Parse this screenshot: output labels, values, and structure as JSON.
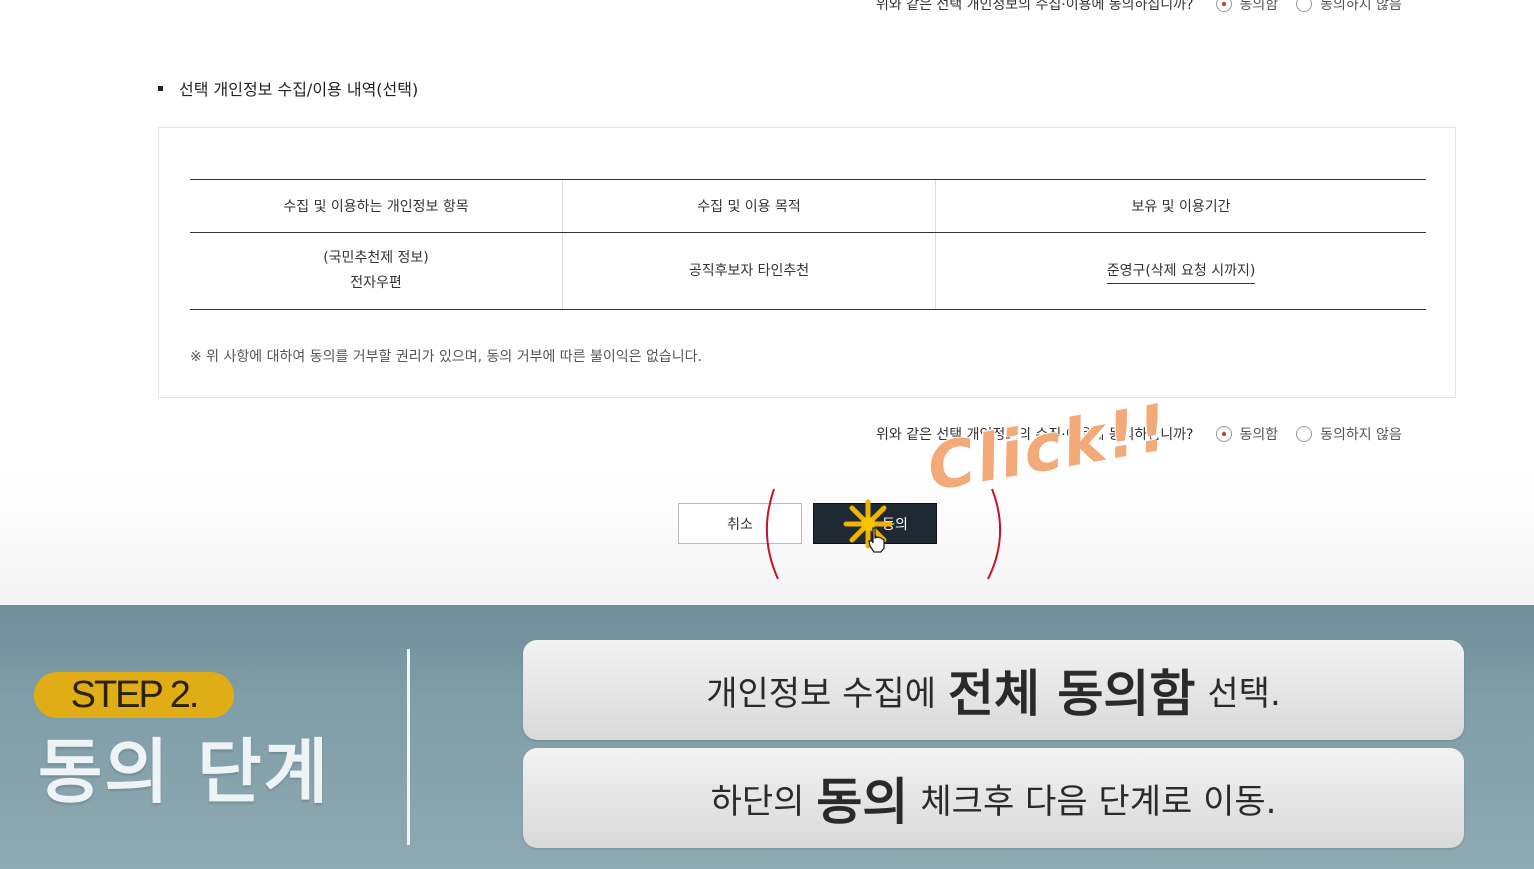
{
  "top_consent": {
    "question": "위와 같은 선택 개인정보의 수집·이용에 동의하십니까?",
    "agree_label": "동의함",
    "disagree_label": "동의하지 않음"
  },
  "section": {
    "title": "선택 개인정보 수집/이용 내역(선택)"
  },
  "table": {
    "headers": [
      "수집 및 이용하는 개인정보 항목",
      "수집 및 이용 목적",
      "보유 및 이용기간"
    ],
    "row": {
      "item_line1": "(국민추천제 정보)",
      "item_line2": "전자우편",
      "purpose": "공직후보자 타인추천",
      "period": "준영구(삭제 요청 시까지)"
    }
  },
  "note": "※ 위 사항에 대하여 동의를 거부할 권리가 있으며, 동의 거부에 따른 불이익은 없습니다.",
  "bottom_consent": {
    "question": "위와 같은 선택 개인정보의 수집·이용에 동의하십니까?",
    "agree_label": "동의함",
    "disagree_label": "동의하지 않음",
    "selected": "agree"
  },
  "buttons": {
    "cancel_label": "취소",
    "agree_label": "동의"
  },
  "annotation": {
    "click_text": "Click!!"
  },
  "tutorial": {
    "step_label": "STEP 2.",
    "step_title": "동의 단계",
    "line1": {
      "pre": "개인정보 수집에",
      "emph": "전체 동의함",
      "post": "선택."
    },
    "line2": {
      "pre": "하단의",
      "emph": "동의",
      "post": "체크후 다음 단계로 이동."
    }
  },
  "colors": {
    "accent_radio": "#c0392b",
    "agree_button": "#1f2933",
    "step_badge": "#e0ad17",
    "click_text": "#f3a978"
  }
}
